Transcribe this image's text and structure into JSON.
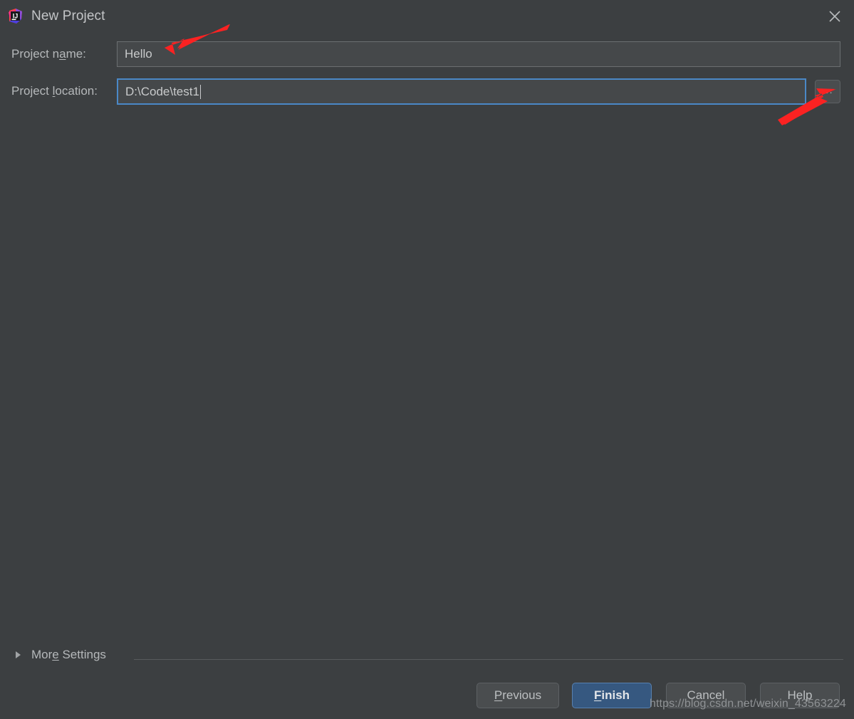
{
  "window": {
    "title": "New Project",
    "icon": "intellij-idea-logo",
    "close_icon": "close-icon",
    "background_color": "#3c3f41"
  },
  "form": {
    "fields": [
      {
        "label_prefix": "Project n",
        "label_mnemonic": "a",
        "label_suffix": "me:",
        "value": "Hello",
        "focused": false
      },
      {
        "label_prefix": "Project ",
        "label_mnemonic": "l",
        "label_suffix": "ocation:",
        "value": "D:\\Code\\test1",
        "focused": true
      }
    ],
    "browse_button_label": "...",
    "focus_border_color": "#4a88c7"
  },
  "more_settings": {
    "label_prefix": "Mor",
    "label_mnemonic": "e",
    "label_suffix": " Settings",
    "expanded": false,
    "triangle_icon": "chevron-right-icon"
  },
  "buttons": [
    {
      "id": "previous",
      "prefix": "",
      "mnemonic": "P",
      "suffix": "revious",
      "primary": false
    },
    {
      "id": "finish",
      "prefix": "",
      "mnemonic": "F",
      "suffix": "inish",
      "primary": true
    },
    {
      "id": "cancel",
      "prefix": "Cancel",
      "mnemonic": "",
      "suffix": "",
      "primary": false
    },
    {
      "id": "help",
      "prefix": "Help",
      "mnemonic": "",
      "suffix": "",
      "primary": false
    }
  ],
  "annotations": {
    "arrow_color": "#fb2222",
    "arrows": [
      {
        "name": "arrow-to-project-name-field",
        "points_to": "project-name-input"
      },
      {
        "name": "arrow-to-browse-button",
        "points_to": "browse-button"
      }
    ]
  },
  "watermark": {
    "text": "https://blog.csdn.net/weixin_43563224"
  }
}
